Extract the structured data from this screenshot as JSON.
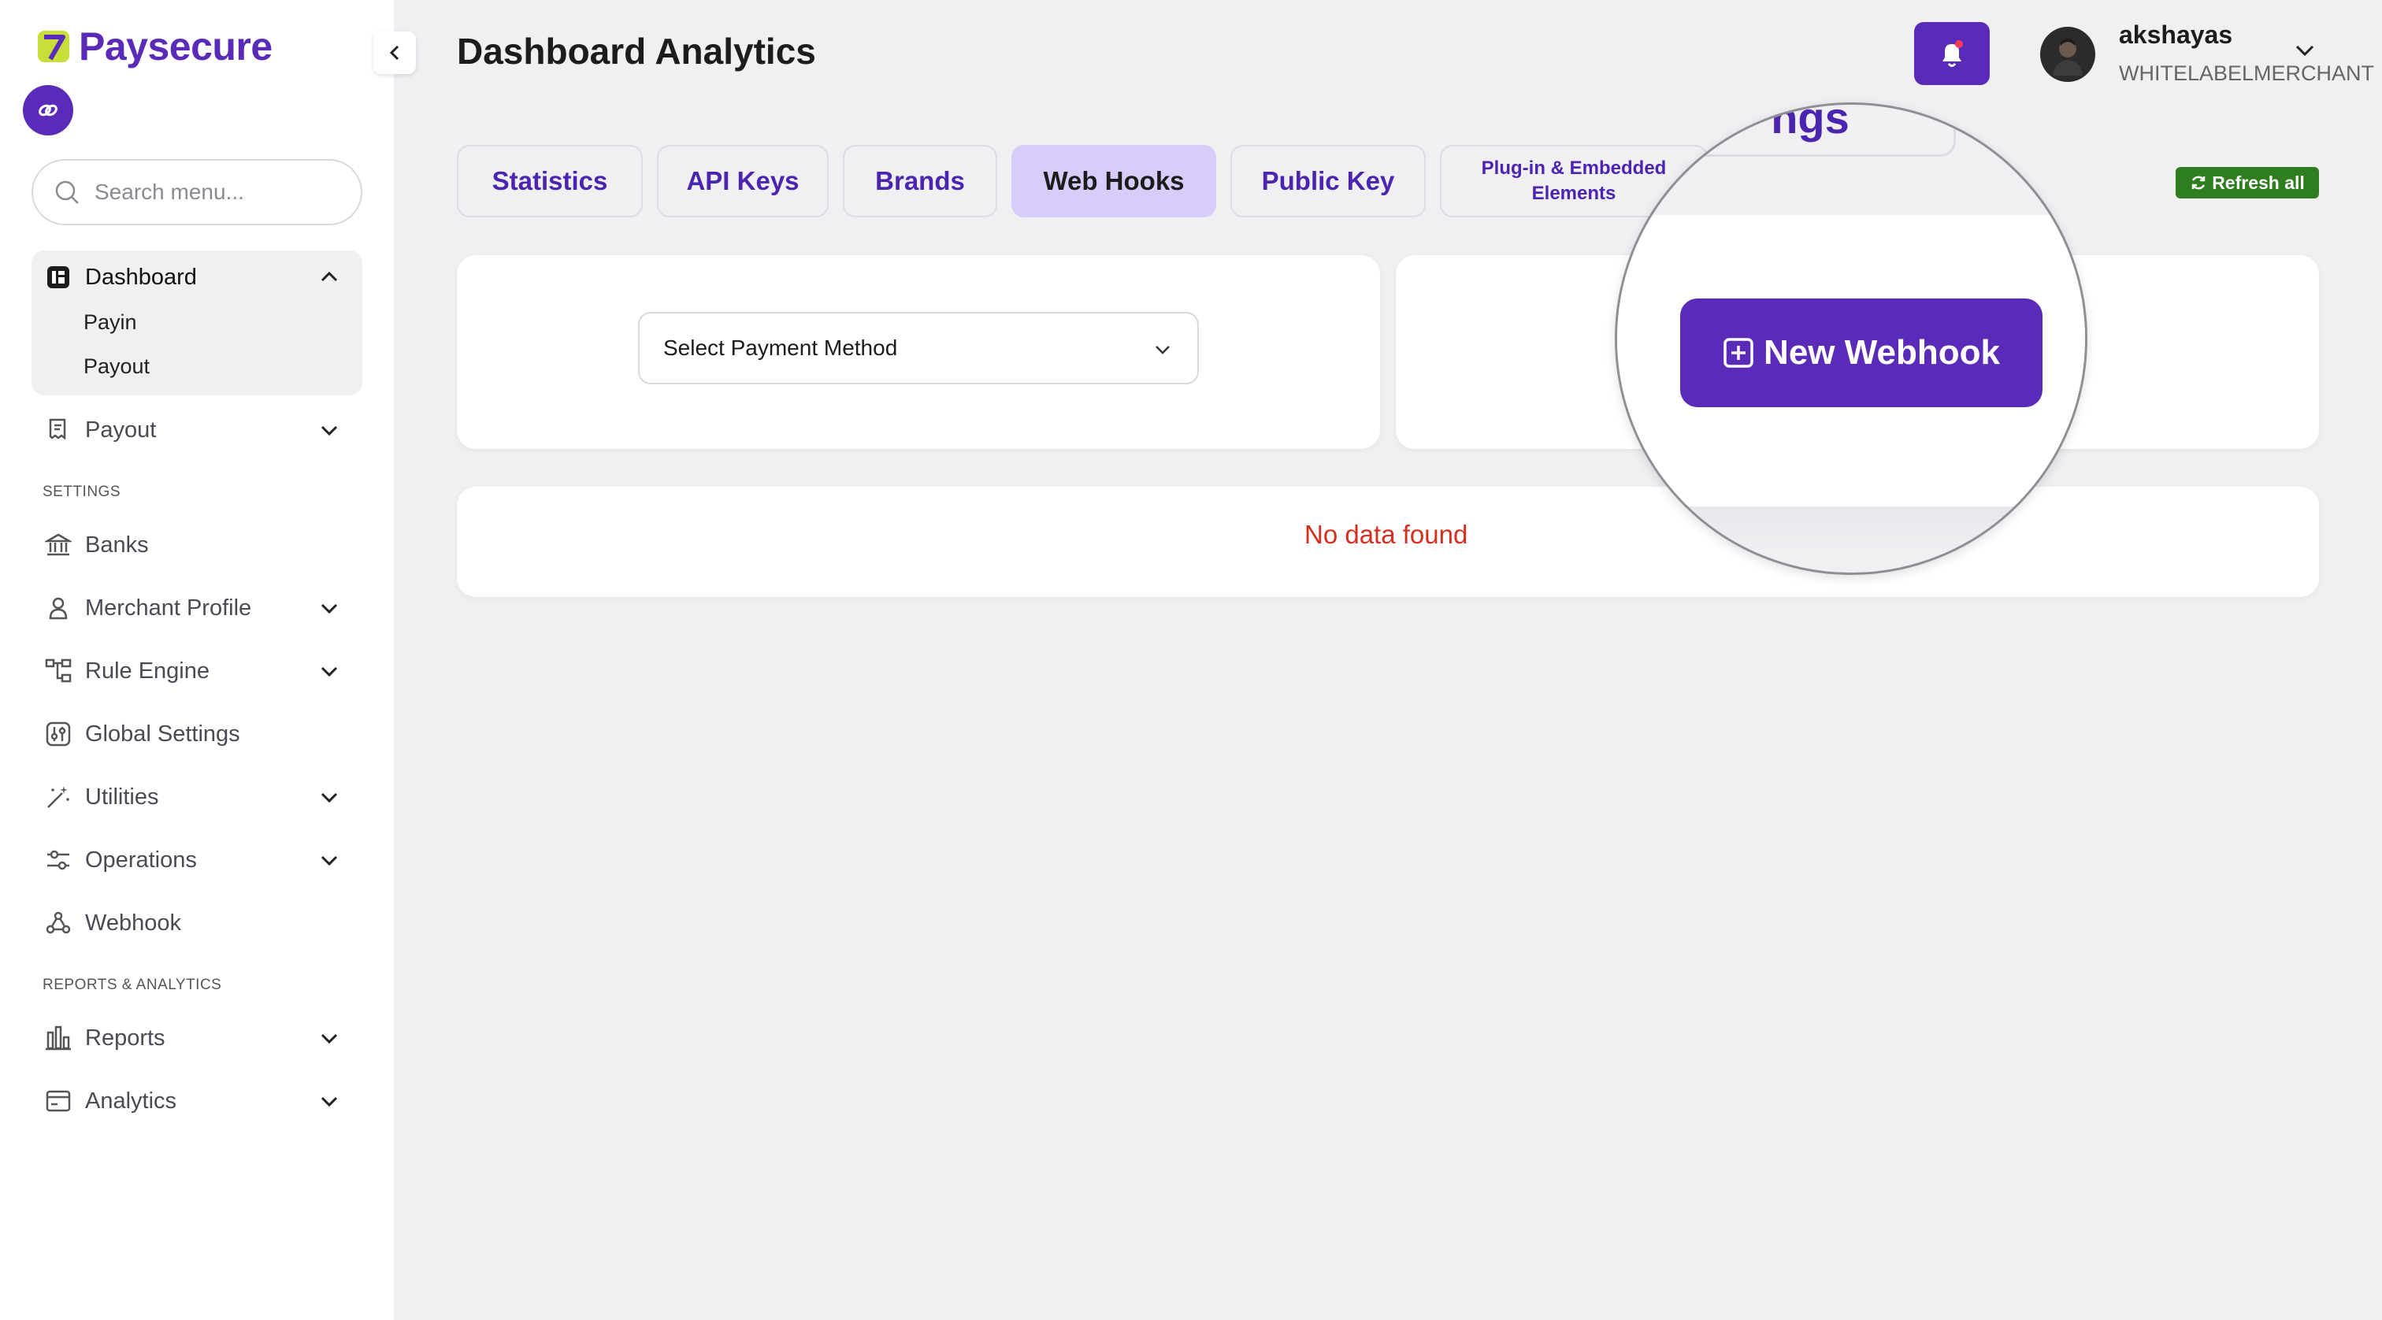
{
  "brand": {
    "name": "Paysecure"
  },
  "colors": {
    "accent": "#5a2bb8",
    "active_tab": "#d8ccfb",
    "error": "#d62f1f",
    "refresh": "#2e7d1f"
  },
  "search": {
    "placeholder": "Search menu..."
  },
  "sidebar": {
    "dashboard": {
      "label": "Dashboard",
      "expanded": true,
      "sub_items": [
        "Payin",
        "Payout"
      ]
    },
    "payout": {
      "label": "Payout"
    },
    "settings_label": "SETTINGS",
    "settings_items": [
      {
        "label": "Banks",
        "icon": "bank-icon"
      },
      {
        "label": "Merchant Profile",
        "icon": "user-icon"
      },
      {
        "label": "Rule Engine",
        "icon": "hierarchy-icon"
      },
      {
        "label": "Global Settings",
        "icon": "sliders-icon"
      },
      {
        "label": "Utilities",
        "icon": "magic-wand-icon"
      },
      {
        "label": "Operations",
        "icon": "settings-sliders-icon"
      },
      {
        "label": "Webhook",
        "icon": "webhook-icon"
      }
    ],
    "reports_label": "REPORTS & ANALYTICS",
    "reports_items": [
      {
        "label": "Reports",
        "icon": "bar-chart-icon"
      },
      {
        "label": "Analytics",
        "icon": "card-icon"
      }
    ]
  },
  "header": {
    "title": "Dashboard Analytics",
    "user": {
      "name": "akshayas",
      "role": "WHITELABELMERCHANT"
    }
  },
  "tabs": [
    {
      "label": "Statistics",
      "active": false
    },
    {
      "label": "API Keys",
      "active": false
    },
    {
      "label": "Brands",
      "active": false
    },
    {
      "label": "Web Hooks",
      "active": true
    },
    {
      "label": "Public Key",
      "active": false
    },
    {
      "label_line1": "Plug-in & Embedded",
      "label_line2": "Elements",
      "active": false
    }
  ],
  "magnified_tab_fragment": "ngs",
  "refresh_label": "Refresh all",
  "filters": {
    "payment_method": "Select Payment Method"
  },
  "actions": {
    "new_webhook": "New Webhook"
  },
  "empty_state": "No data found"
}
